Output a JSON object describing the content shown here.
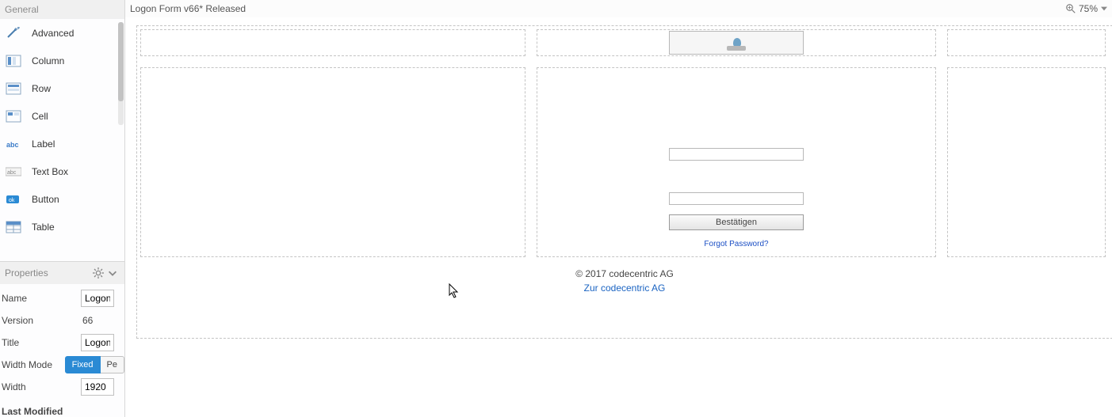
{
  "sidebar": {
    "header": "General",
    "items": [
      {
        "label": "Advanced"
      },
      {
        "label": "Column"
      },
      {
        "label": "Row"
      },
      {
        "label": "Cell"
      },
      {
        "label": "Label"
      },
      {
        "label": "Text Box"
      },
      {
        "label": "Button"
      },
      {
        "label": "Table"
      }
    ]
  },
  "properties": {
    "header": "Properties",
    "rows": {
      "name_label": "Name",
      "name_value": "Logon",
      "version_label": "Version",
      "version_value": "66",
      "title_label": "Title",
      "title_value": "Logon",
      "widthmode_label": "Width Mode",
      "widthmode_fixed": "Fixed",
      "widthmode_percent": "Pe",
      "width_label": "Width",
      "width_value": "1920",
      "lastmod_label": "Last Modified"
    }
  },
  "topbar": {
    "title": "Logon Form v66* Released",
    "zoom": "75%"
  },
  "design": {
    "confirm_label": "Bestätigen",
    "forgot_label": "Forgot Password?",
    "footer_copy": "© 2017 codecentric AG",
    "footer_link": "Zur codecentric AG"
  }
}
